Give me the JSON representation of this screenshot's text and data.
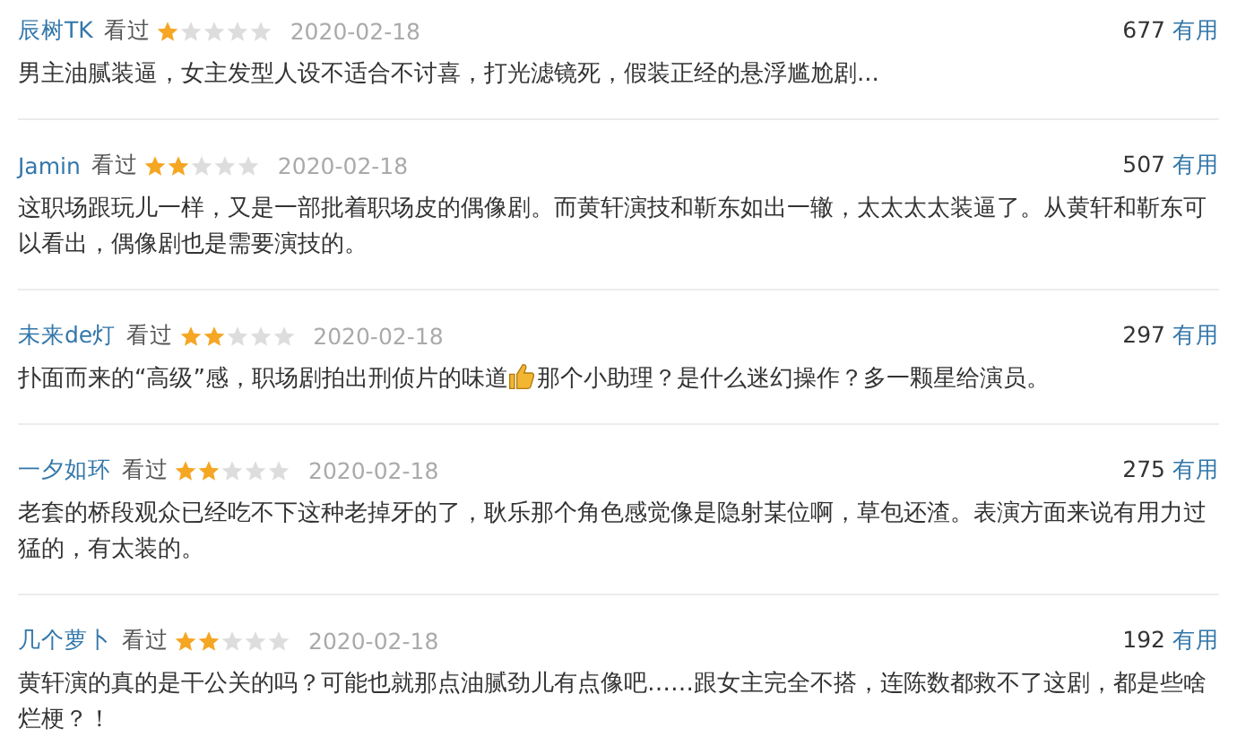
{
  "reviews": [
    {
      "user": "辰树TK",
      "status": "看过",
      "stars": 1,
      "date": "2020-02-18",
      "votes": "677",
      "vote_label": "有用",
      "body": "男主油腻装逼，女主发型人设不适合不讨喜，打光滤镜死，假装正经的悬浮尴尬剧..."
    },
    {
      "user": "Jamin",
      "status": "看过",
      "stars": 2,
      "date": "2020-02-18",
      "votes": "507",
      "vote_label": "有用",
      "body": "这职场跟玩儿一样，又是一部批着职场皮的偶像剧。而黄轩演技和靳东如出一辙，太太太太装逼了。从黄轩和靳东可以看出，偶像剧也是需要演技的。"
    },
    {
      "user": "未来de灯",
      "status": "看过",
      "stars": 2,
      "date": "2020-02-18",
      "votes": "297",
      "vote_label": "有用",
      "body": "扑面而来的“高级”感，职场剧拍出刑侦片的味道",
      "body_after_icon": "那个小助理？是什么迷幻操作？多一颗星给演员。"
    },
    {
      "user": "一夕如环",
      "status": "看过",
      "stars": 2,
      "date": "2020-02-18",
      "votes": "275",
      "vote_label": "有用",
      "body": "老套的桥段观众已经吃不下这种老掉牙的了，耿乐那个角色感觉像是隐射某位啊，草包还渣。表演方面来说有用力过猛的，有太装的。"
    },
    {
      "user": "几个萝卜",
      "status": "看过",
      "stars": 2,
      "date": "2020-02-18",
      "votes": "192",
      "vote_label": "有用",
      "body": "黄轩演的真的是干公关的吗？可能也就那点油腻劲儿有点像吧……跟女主完全不搭，连陈数都救不了这剧，都是些啥烂梗？！"
    }
  ]
}
